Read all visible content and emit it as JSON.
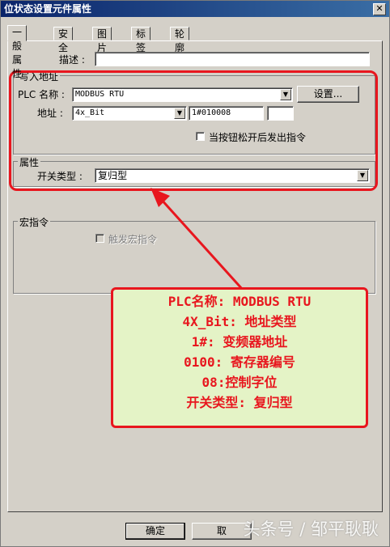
{
  "window": {
    "title": "位状态设置元件属性",
    "close_glyph": "✕"
  },
  "tabs": [
    {
      "label": "一般属性"
    },
    {
      "label": "安全"
    },
    {
      "label": "图片"
    },
    {
      "label": "标签"
    },
    {
      "label": "轮廓"
    }
  ],
  "description": {
    "label": "描述 :",
    "value": ""
  },
  "write_address": {
    "group_title": "写入地址",
    "plc_label": "PLC 名称 :",
    "plc_value": "MODBUS RTU",
    "settings_button": "设置...",
    "address_label": "地址 :",
    "address_type": "4x_Bit",
    "address_value": "1#010008",
    "release_checkbox_label": "当按钮松开后发出指令",
    "release_checked": false
  },
  "attributes": {
    "group_title": "属性",
    "switch_type_label": "开关类型 :",
    "switch_type_value": "复归型"
  },
  "macro": {
    "group_title": "宏指令",
    "trigger_label": "触发宏指令",
    "trigger_checked": false
  },
  "annotation": {
    "lines": [
      "PLC名称: MODBUS RTU",
      "4X_Bit: 地址类型",
      "1#: 变频器地址",
      "0100: 寄存器编号",
      "08:控制字位",
      "开关类型: 复归型"
    ],
    "color": "#e8161e",
    "background": "#e4f3c6"
  },
  "footer": {
    "ok_button": "确定",
    "cancel_button": "取"
  },
  "watermark": "头条号 / 邹平耿耿"
}
